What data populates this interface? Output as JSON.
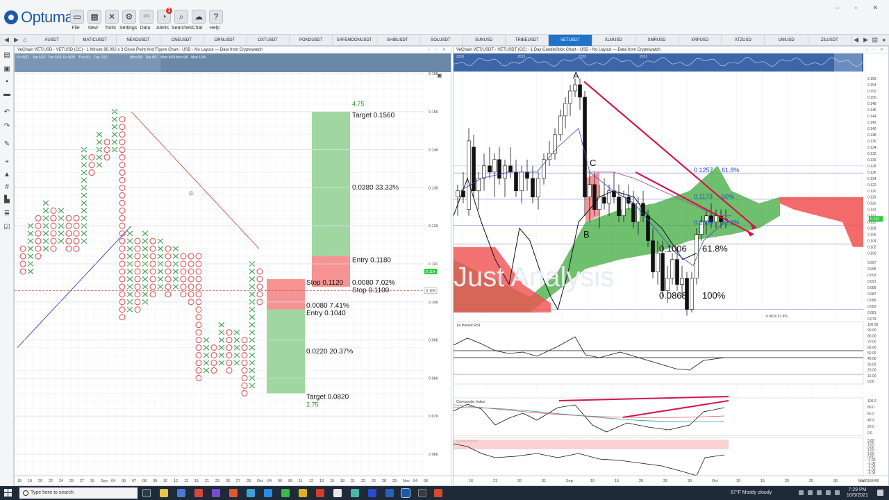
{
  "app": {
    "brand": "Optuma",
    "toolbar": [
      {
        "label": "File",
        "icon": "folder-icon"
      },
      {
        "label": "New",
        "icon": "new-doc-icon"
      },
      {
        "label": "Tools",
        "icon": "tools-icon"
      },
      {
        "label": "Settings",
        "icon": "gear-icon"
      },
      {
        "label": "Data",
        "icon": "data-icon"
      },
      {
        "label": "Alerts",
        "icon": "alarm-icon",
        "badge": "3"
      },
      {
        "label": "Searches",
        "icon": "search-icon"
      },
      {
        "label": "Chat",
        "icon": "chat-icon"
      },
      {
        "label": "Help",
        "icon": "help-icon"
      }
    ],
    "data_icon_text": "101",
    "help_glyph": "?"
  },
  "tabs": [
    {
      "label": "AUSDT"
    },
    {
      "label": "MATICUSDT"
    },
    {
      "label": "NEXOUSDT"
    },
    {
      "label": "ONEUSDT"
    },
    {
      "label": "ORNUSDT"
    },
    {
      "label": "OXTUSDT"
    },
    {
      "label": "PONDUSDT"
    },
    {
      "label": "SAFEMOONUSDT"
    },
    {
      "label": "SHIBUSDT"
    },
    {
      "label": "SOLUSDT"
    },
    {
      "label": "SUNUSD"
    },
    {
      "label": "TRIBEUSDT"
    },
    {
      "label": "VETUSDT",
      "active": true
    },
    {
      "label": "XLMUSD"
    },
    {
      "label": "XMRUSD"
    },
    {
      "label": "XRPUSD"
    },
    {
      "label": "XTZUSD"
    },
    {
      "label": "UNIUSD"
    },
    {
      "label": "ZILUSDT"
    }
  ],
  "left_chart": {
    "title": "VeChain VET/USD - VETUSD (CC) - 1 Minute $0.002 x 3 Close Point And Figure Chart - USD - No Layout — Data from Cryptowatch",
    "nav_dates": [
      "Fri 5/21",
      "Sat 5/22",
      "Tue 5/25",
      "Fri 5/28",
      "Thu 6/3",
      "Tue 7/20",
      "Mon 8/9",
      "Tue 8/17",
      "Wed 8/25",
      "Mon 9/6",
      "Mon 10/4"
    ],
    "price_axis": [
      "0.166",
      "0.156",
      "0.146",
      "0.136",
      "0.126",
      "0.116",
      "0.106",
      "0.096",
      "0.086",
      "0.076",
      "0.066"
    ],
    "last_price": "0.114",
    "ref_price": "0.109",
    "x_labels": [
      "18",
      "19",
      "20",
      "22",
      "24",
      "25",
      "27",
      "30",
      "Sep",
      "04",
      "06",
      "07",
      "08",
      "09",
      "10",
      "12",
      "13",
      "15",
      "21",
      "23",
      "26",
      "27",
      "28",
      "Oct",
      "04",
      "06",
      "08",
      "11",
      "12",
      "13",
      "15",
      "18",
      "21",
      "22",
      "26",
      "28",
      "29",
      "Nov",
      "04",
      "06"
    ],
    "long_trade": {
      "ratio": "4.75",
      "target_label": "Target  0.1560",
      "reward_label": "0.0380  33.33%",
      "entry_label": "Entry  0.1180",
      "risk_label": "0.0080  7.02%",
      "stop_label": "Stop  0.1100"
    },
    "short_trade": {
      "stop_label": "Stop  0.1120",
      "risk_label": "0.0080  7.41%",
      "entry_label": "Entry  0.1040",
      "reward_label": "0.0220  20.37%",
      "target_label": "Target  0.0820",
      "ratio": "2.75"
    }
  },
  "right_chart": {
    "title": "VeChain VET/USDT - VETUSDT (CC) - 1 Day CandleStick Chart - USD - No Layout — Data from Cryptowatch",
    "nav_years": [
      "2018",
      "2019",
      "2020",
      "2021"
    ],
    "price_axis": [
      "0.156",
      "0.154",
      "0.152",
      "0.150",
      "0.148",
      "0.146",
      "0.144",
      "0.142",
      "0.140",
      "0.138",
      "0.136",
      "0.134",
      "0.132",
      "0.130",
      "0.128",
      "0.126",
      "0.124",
      "0.122",
      "0.120",
      "0.118",
      "0.116",
      "0.114",
      "0.112",
      "0.110",
      "0.108",
      "0.106",
      "0.104",
      "0.102",
      "0.100",
      "0.097",
      "0.095",
      "0.093",
      "0.091",
      "0.089",
      "0.087",
      "0.085",
      "0.083",
      "0.081",
      "0.079"
    ],
    "last_price": "0.111",
    "points": {
      "a": "A",
      "b": "B",
      "c": "C"
    },
    "fib_up": [
      {
        "value": "0.1257",
        "pct": "61.8%"
      },
      {
        "value": "0.1173",
        "pct": "50%"
      },
      {
        "value": "0.1089",
        "pct": "38.2%"
      }
    ],
    "fib_down": [
      {
        "value": "0.1006",
        "pct": "61.8%"
      },
      {
        "value": "0.0868",
        "pct": "100%"
      }
    ],
    "small_fib": "0.0816   61.8%",
    "watermark": "Just Analysis",
    "rsi": {
      "title": "14 Period RSI",
      "axis": [
        "100.00",
        "90.00",
        "80.00",
        "70.00",
        "60.00",
        "50.00",
        "40.00",
        "30.00",
        "20.00",
        "10.00",
        "0.00"
      ]
    },
    "composite": {
      "title": "Composite Index",
      "axis": [
        "100.0",
        "80.0",
        "60.0",
        "40.0",
        "20.0",
        "0.0"
      ]
    },
    "optex": {
      "title": "Optex Bands",
      "axis": [
        "5.00",
        "4.00",
        "3.00",
        "2.00",
        "1.00",
        "0.00",
        "-1.00",
        "-2.00",
        "-3.00",
        "-4.00",
        "-5.00"
      ]
    },
    "x_labels": [
      "16",
      "21",
      "26",
      "31",
      "Sep",
      "10",
      "15",
      "20",
      "25",
      "30",
      "Oct",
      "10",
      "15",
      "20",
      "25",
      "30",
      "Nov"
    ],
    "bottom_readout": "0.00158496"
  },
  "taskbar": {
    "search_placeholder": "Type here to search",
    "weather": "67°F  Mostly cloudy",
    "time": "7:29 PM",
    "date": "10/5/2021"
  },
  "colors": {
    "accent": "#1f73c8",
    "green_cloud": "#3daa3d",
    "red_cloud": "#f05050",
    "x_green": "#3aa04a",
    "o_red": "#e05555",
    "arrow": "#d4154a"
  }
}
